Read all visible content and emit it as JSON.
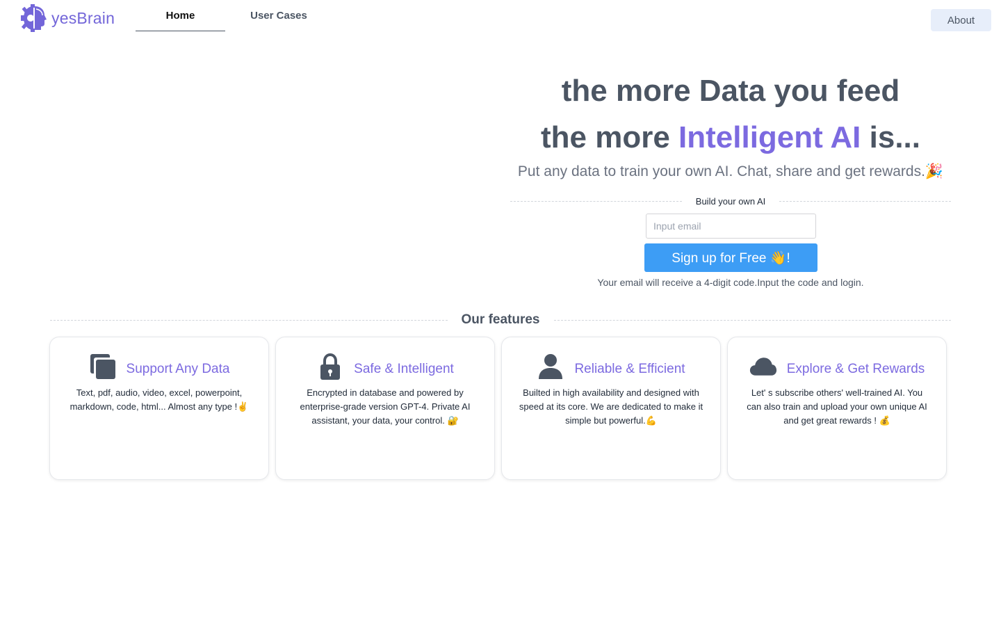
{
  "brand": {
    "name": "yesBrain",
    "logo_icon": "brain-gear-head-icon",
    "color": "#7366d9"
  },
  "nav": {
    "tabs": [
      {
        "label": "Home",
        "active": true
      },
      {
        "label": "User Cases",
        "active": false
      }
    ],
    "about_label": "About"
  },
  "hero": {
    "line1": "the more Data you feed",
    "line2_prefix": "the more ",
    "line2_accent": "Intelligent AI",
    "line2_suffix": " is...",
    "subtitle": "Put any data to train your own AI. Chat, share and get rewards.🎉",
    "accent_color": "#7c6ae0"
  },
  "signup": {
    "section_label": "Build your own AI",
    "email_placeholder": "Input email",
    "email_value": "",
    "button_label": "Sign up for Free 👋!",
    "hint": "Your email will receive a 4-digit code.Input the code and login.",
    "button_color": "#3d9df5"
  },
  "features": {
    "heading": "Our features",
    "cards": [
      {
        "icon": "copy-icon",
        "title": "Support Any Data",
        "text": "Text, pdf, audio, video, excel, powerpoint, markdown, code, html... Almost any type !✌️"
      },
      {
        "icon": "lock-icon",
        "title": "Safe & Intelligent",
        "text": "Encrypted in database and powered by enterprise-grade version GPT-4. Private AI assistant, your data, your control. 🔐"
      },
      {
        "icon": "user-icon",
        "title": "Reliable & Efficient",
        "text": "Builted in high availability and designed with speed at its core. We are dedicated to make it simple but powerful.💪"
      },
      {
        "icon": "cloud-icon",
        "title": "Explore & Get Rewards",
        "text": "Let' s subscribe others' well-trained AI. You can also train and upload your own unique AI and get great rewards ! 💰"
      }
    ]
  }
}
